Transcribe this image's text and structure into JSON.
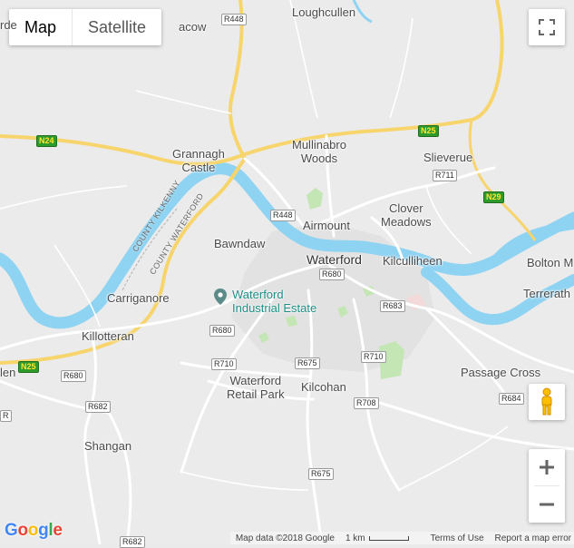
{
  "map_type_control": {
    "map_label": "Map",
    "satellite_label": "Satellite",
    "active": "map"
  },
  "places": {
    "waterford": "Waterford",
    "loughcullen": "Loughcullen",
    "mullinabro_1": "Mullinabro",
    "mullinabro_2": "Woods",
    "grannagh_1": "Grannagh",
    "grannagh_2": "Castle",
    "slievenue": "Slieverue",
    "clover_1": "Clover",
    "clover_2": "Meadows",
    "airmount": "Airmount",
    "bawndaw": "Bawndaw",
    "kilculliheen": "Kilculliheen",
    "bolton": "Bolton M",
    "terrerath": "Terrerath",
    "carriganore": "Carriganore",
    "killotteran": "Killotteran",
    "wrp_1": "Waterford",
    "wrp_2": "Retail Park",
    "kilcohan": "Kilcohan",
    "passage_cross": "Passage Cross",
    "shangan": "Shangan",
    "cut_acow": "acow",
    "cut_rde": "rde",
    "cut_len": "len"
  },
  "poi": {
    "line1": "Waterford",
    "line2": "Industrial Estate",
    "icon": "place-pin-icon"
  },
  "road_labels": {
    "r448_top": "R448",
    "r448_mid": "R448",
    "n24": "N24",
    "n25_east": "N25",
    "n25_west": "N25",
    "n29": "N29",
    "r711": "R711",
    "r680_city": "R680",
    "r680_mid": "R680",
    "r680_sw": "R680",
    "r683": "R683",
    "r710_w": "R710",
    "r710_e": "R710",
    "r675_mid": "R675",
    "r675_south": "R675",
    "r708": "R708",
    "r682_w": "R682",
    "r682_s": "R682",
    "r684": "R684",
    "cut_r": "R"
  },
  "county_labels": {
    "kilkenny": "COUNTY KILKENNY",
    "waterford": "COUNTY WATERFORD"
  },
  "controls": {
    "fullscreen_icon": "fullscreen-icon",
    "pegman_icon": "pegman-icon",
    "zoom_in_icon": "plus-icon",
    "zoom_out_icon": "minus-icon"
  },
  "footer": {
    "map_data": "Map data ©2018 Google",
    "scale": "1 km",
    "terms": "Terms of Use",
    "report": "Report a map error"
  },
  "logo": {
    "g1": "G",
    "o1": "o",
    "o2": "o",
    "g2": "g",
    "l": "l",
    "e": "e"
  },
  "colors": {
    "land": "#eaeaea",
    "water": "#8fd3f2",
    "park": "#c4e6b4",
    "motorway": "#f7d56c",
    "road": "#ffffff"
  }
}
